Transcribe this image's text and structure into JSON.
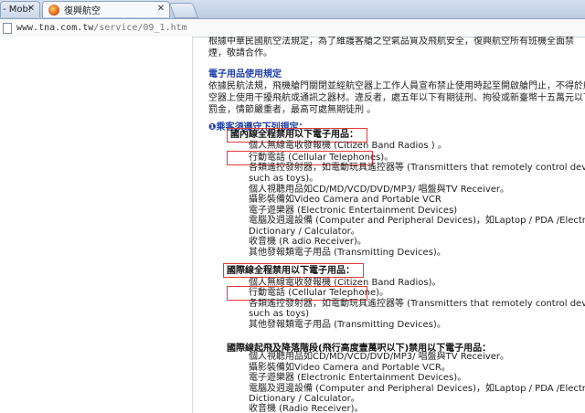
{
  "browser": {
    "tabs": [
      {
        "label": "- Mob: ",
        "active": false
      },
      {
        "label": "復興航空",
        "active": true
      }
    ],
    "url_host": "www.tna.com.tw",
    "url_path": "/service/09_1.htm"
  },
  "page": {
    "intro_lines": [
      "根據中華民國航空法規定，為了維護客艙之空氣品質及飛航安全，復興航空所有班機全面禁",
      "煙，敬請合作。"
    ],
    "electronics_title": "電子用品使用規定",
    "electronics_lines": [
      "依據民航法規，飛機艙門關閉並經航空器上工作人員宣布禁止使用時起至開啟艙門止，不得於航",
      "空器上使用干擾飛航或通訊之器材。違反者，處五年以下有期徒刑、拘役或新臺幣十五萬元以下",
      "罰金，情節嚴重者，最高可處無期徒刑 。"
    ],
    "passenger_rules_title": "❶乘客須遵守下列規定：",
    "domestic": {
      "title": "國內線全程禁用以下電子用品：",
      "items": [
        "個人無線電收發報機 (Citizen Band Radios ) 。",
        "行動電話 (Cellular Telephones)。",
        "各類遙控發射器，如電動玩具遙控器等 (Transmitters that remotely control devices",
        "such as toys)。",
        "個人視聽用品如CD/MD/VCD/DVD/MP3/ 唱盤與TV Receiver。",
        "攝影裝備如Video Camera and Portable VCR",
        "電子遊樂器 (Electronic Entertainment Devices)",
        "電腦及週邊設備 (Computer and Peripheral Devices)，如Laptop / PDA /Electronic",
        "Dictionary / Calculator。",
        "收音機 (R adio Receiver)。",
        "其他發報類電子用品 (Transmitting Devices)。"
      ]
    },
    "international": {
      "title": "國際線全程禁用以下電子用品：",
      "items": [
        "個人無線電收發報機 (Citizen Band Radios)。",
        "行動電話 (Cellular Telephone)。",
        "各類遙控發射器，如電動玩具遙控器等 (Transmitters that remotely control devices",
        "such as toys)",
        "其他發報類電子用品 (Transmitting Devices)。"
      ]
    },
    "takeoff_landing": {
      "title": "國際線起飛及降落階段(飛行高度壹萬呎以下)禁用以下電子用品：",
      "items": [
        "個人視聽用品如CD/MD/VCD/DVD/MP3/ 唱盤與TV Receiver。",
        "攝影裝備如Video Camera and Portable VCR。",
        "電子遊樂器 (Electronic Entertainment Devices)。",
        "電腦及週邊設備 (Computer and Peripheral Devices)，如Laptop / PDA /Electronic",
        "Dictionary / Calculator。",
        "收音機 (Radio Receiver)。"
      ]
    }
  },
  "colors": {
    "heading_blue": "#1f3fa8",
    "highlight_box": "#e23a3a"
  }
}
